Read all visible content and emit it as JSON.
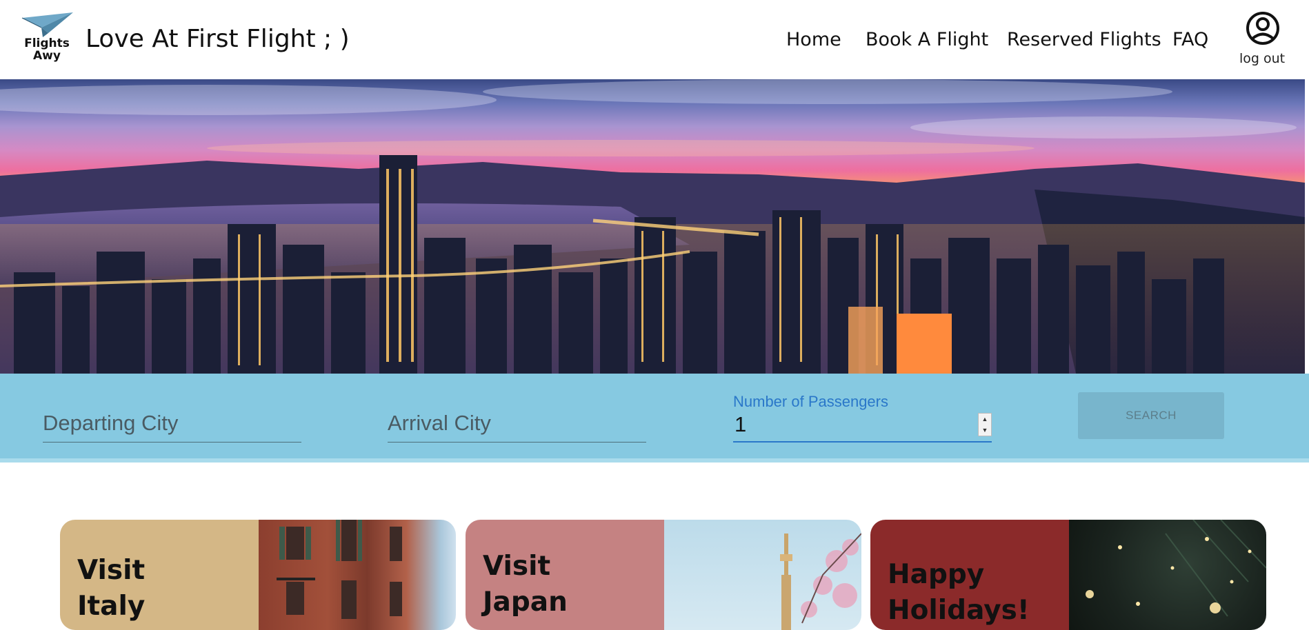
{
  "header": {
    "logo_text_line1": "Flights",
    "logo_text_line2": "Awy",
    "site_title": "Love At First Flight ; )",
    "nav": [
      {
        "label": "Home"
      },
      {
        "label": "Book A Flight"
      },
      {
        "label": "Reserved Flights"
      },
      {
        "label": "FAQ"
      }
    ],
    "logout_label": "log out",
    "user_icon": "account-circle-icon"
  },
  "search": {
    "departing_placeholder": "Departing City",
    "arrival_placeholder": "Arrival City",
    "passengers_label": "Number of Passengers",
    "passengers_value": "1",
    "search_label": "SEARCH"
  },
  "cards": [
    {
      "title_line1": "Visit",
      "title_line2": "Italy",
      "color": "#d4b786"
    },
    {
      "title_line1": "Visit",
      "title_line2": "Japan",
      "color": "#c58282"
    },
    {
      "title_line1": "Happy",
      "title_line2": "Holidays!",
      "color": "#8b2a2a"
    }
  ],
  "colors": {
    "search_bar": "#86c9e1",
    "passenger_accent": "#2a77c9"
  }
}
